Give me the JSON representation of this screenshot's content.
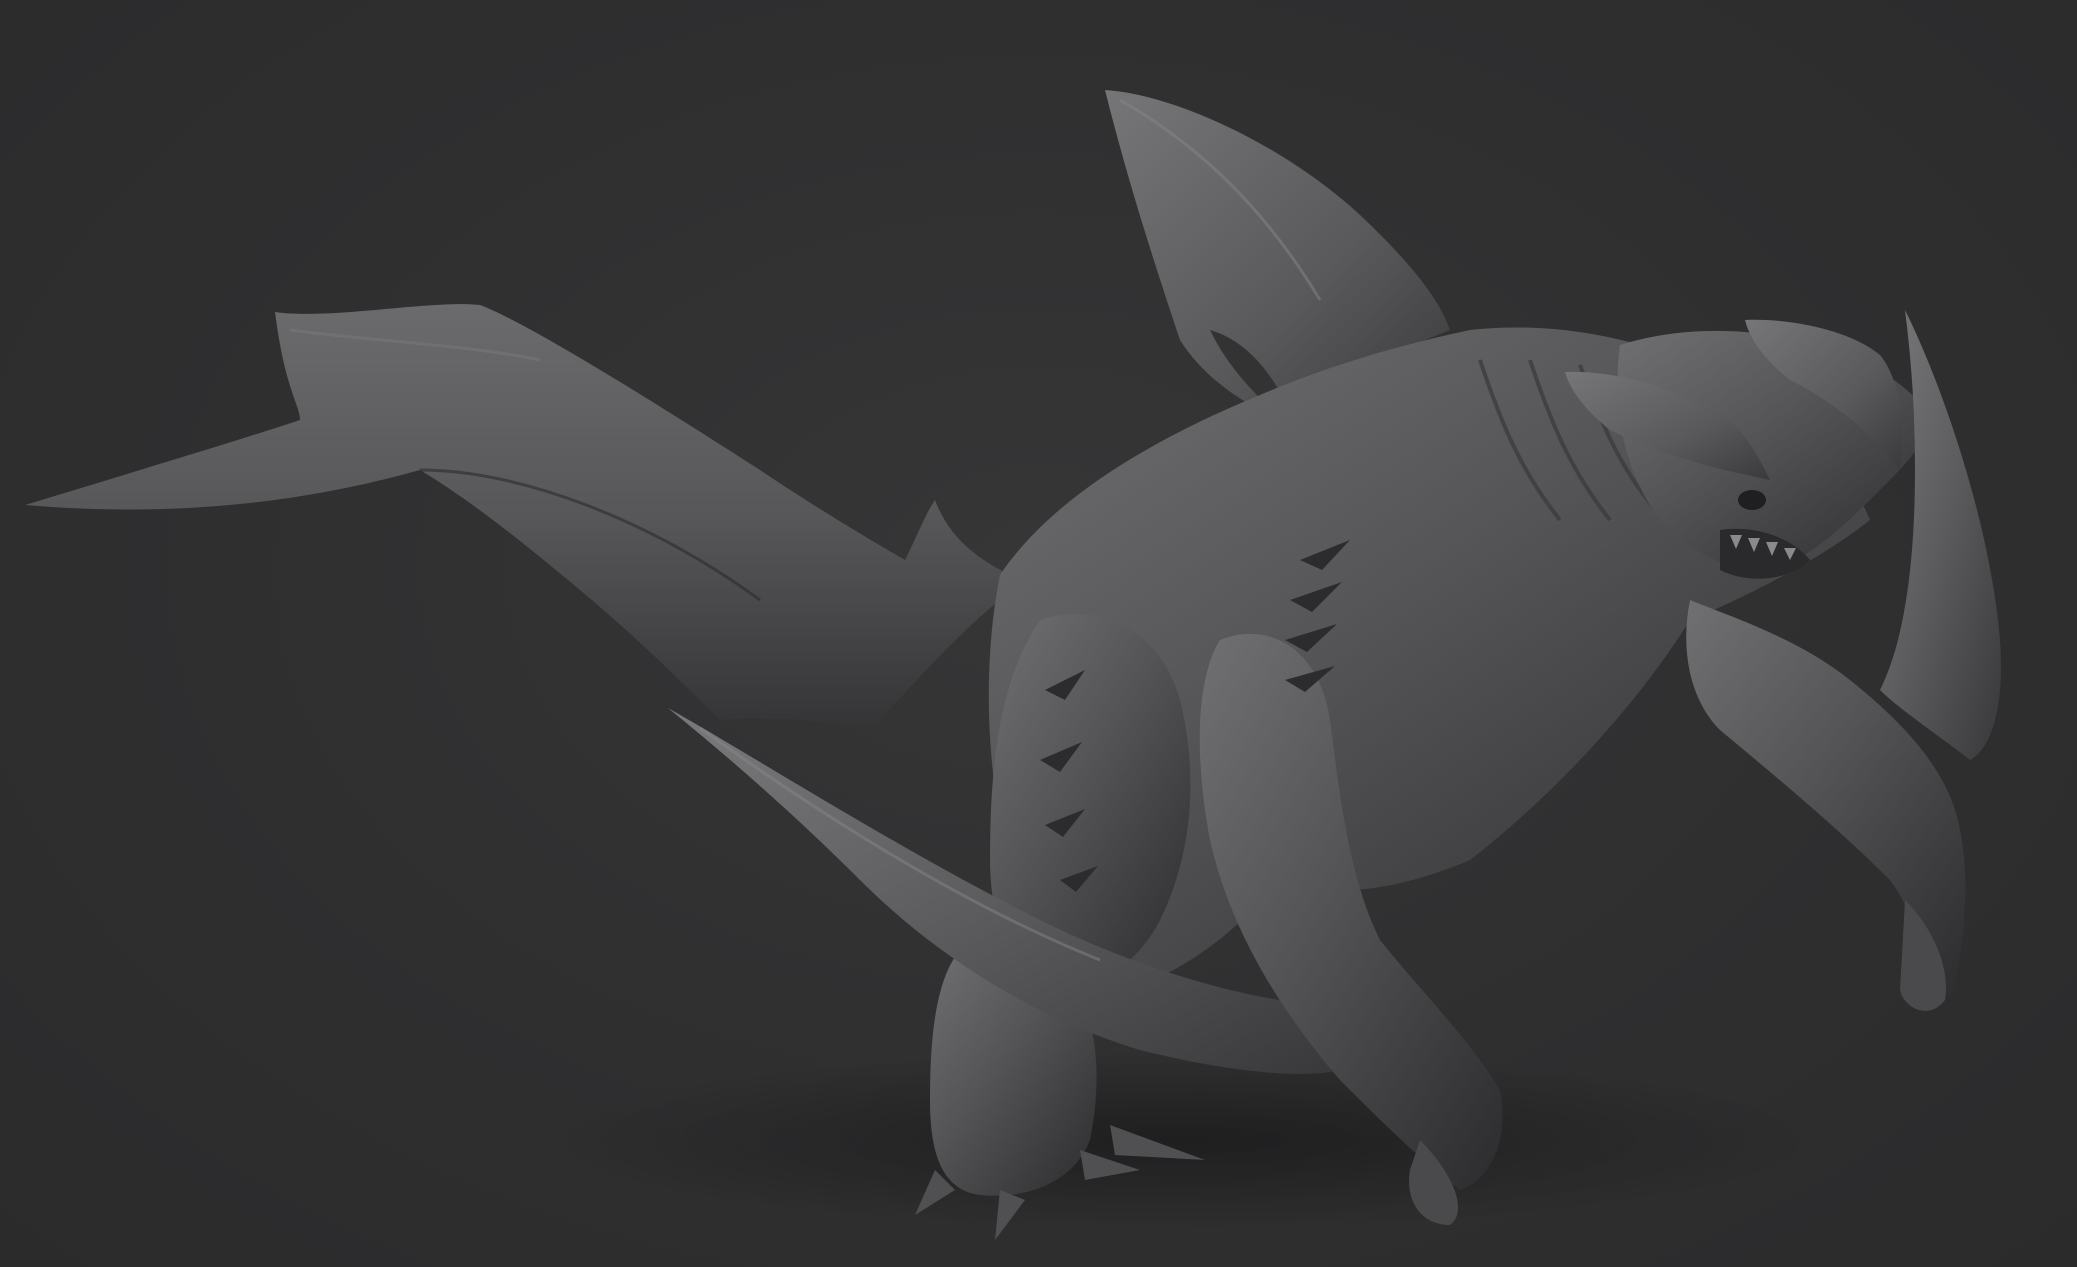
{
  "scene": {
    "subject": "sculpt-model",
    "colors": {
      "background": "#2f2f30",
      "clay_light": "#6d6d6f",
      "clay_mid": "#4f4f51",
      "clay_dark": "#303032",
      "shadow": "#1e1e20"
    }
  }
}
